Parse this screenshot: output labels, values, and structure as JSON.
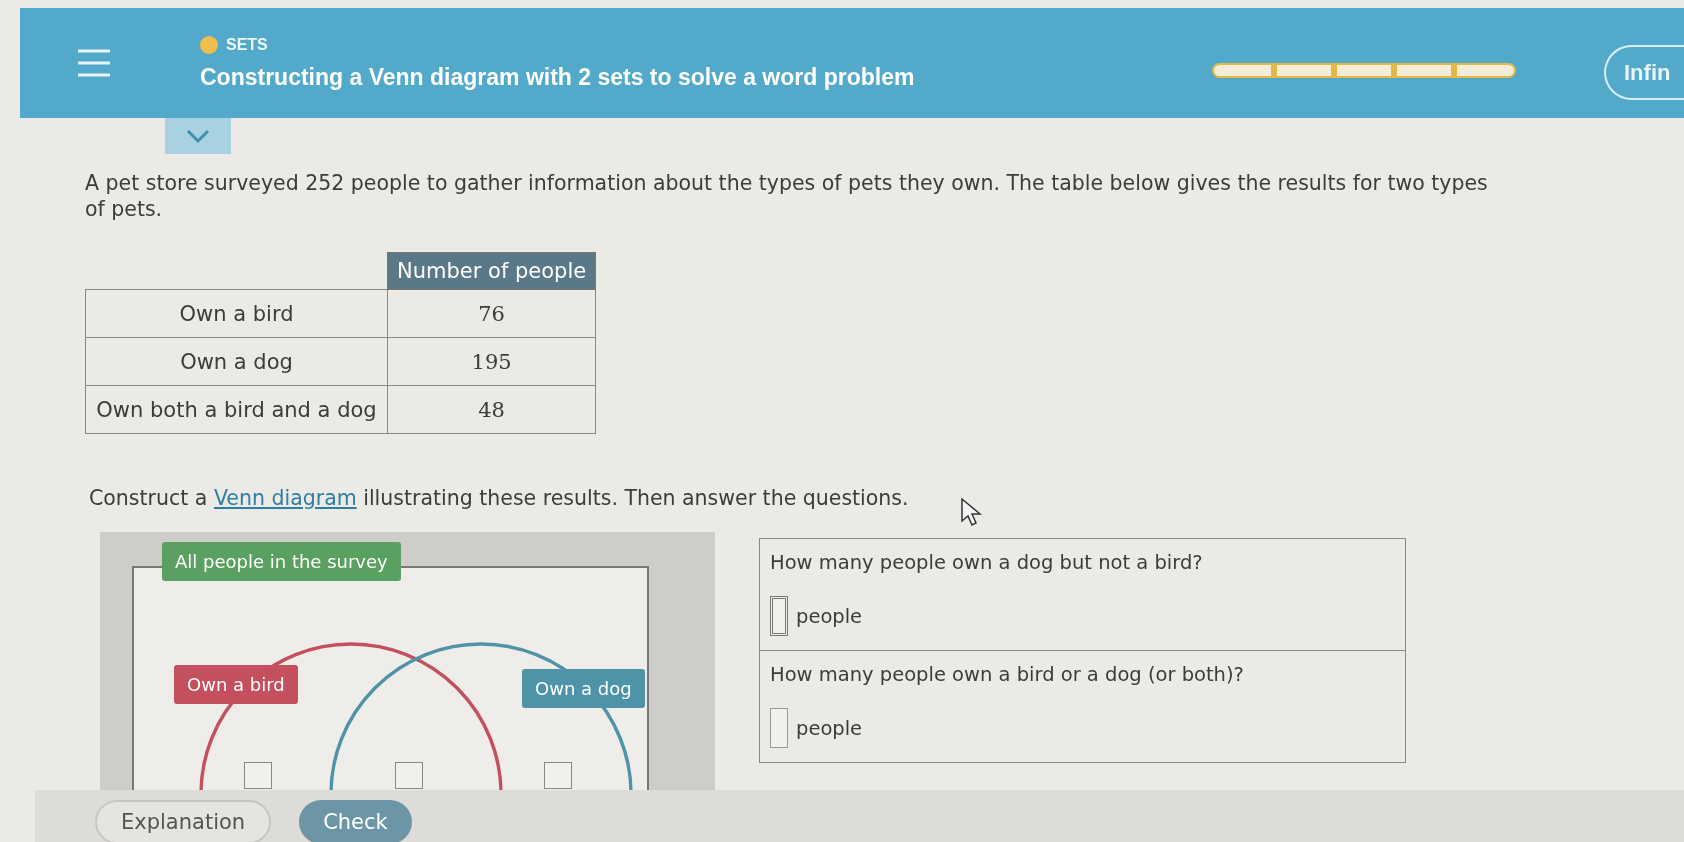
{
  "header": {
    "topic": "SETS",
    "title": "Constructing a Venn diagram with 2 sets to solve a word problem",
    "progress": {
      "level": 0
    },
    "mode_button": "Infin"
  },
  "problem": "A pet store surveyed 252 people to gather information about the types of pets they own. The table below gives the results for two types of pets.",
  "table": {
    "columns": [
      "Number of people"
    ],
    "rows": [
      {
        "label": "Own a bird",
        "value": "76"
      },
      {
        "label": "Own a dog",
        "value": "195"
      },
      {
        "label": "Own both a bird and a dog",
        "value": "48"
      }
    ]
  },
  "instruction": {
    "before": "Construct a ",
    "link": "Venn diagram",
    "after": " illustrating these results. Then answer the questions."
  },
  "venn": {
    "universe": "All people in the survey",
    "sets": [
      {
        "label": "Own a bird",
        "color": "#c4505e"
      },
      {
        "label": "Own a dog",
        "color": "#4f93a8"
      }
    ]
  },
  "questions": [
    {
      "text": "How many people own a dog but not a bird?",
      "unit": "people",
      "focused": true
    },
    {
      "text": "How many people own a bird or a dog (or both)?",
      "unit": "people",
      "focused": false
    }
  ],
  "buttons": [
    {
      "label": "Explanation",
      "kind": "secondary"
    },
    {
      "label": "Check",
      "kind": "primary"
    }
  ]
}
